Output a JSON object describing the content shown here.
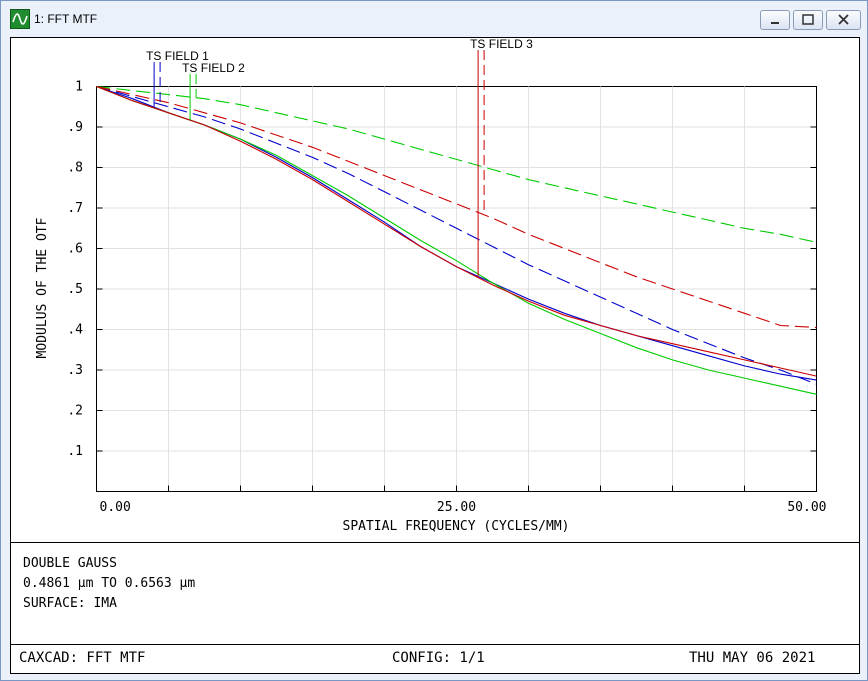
{
  "window": {
    "title": "1: FFT MTF",
    "icon": "sine-wave-icon",
    "controls": [
      "minimize-icon",
      "maximize-icon",
      "close-icon"
    ]
  },
  "info": {
    "lens": "DOUBLE GAUSS",
    "wavelength": "0.4861 µm TO 0.6563 µm",
    "surface": "SURFACE: IMA"
  },
  "footer": {
    "left": "CAXCAD: FFT MTF",
    "center": "CONFIG: 1/1",
    "right": "THU MAY 06 2021"
  },
  "chart_data": {
    "type": "line",
    "xlabel": "SPATIAL FREQUENCY (CYCLES/MM)",
    "ylabel": "MODULUS OF THE OTF",
    "xlim": [
      0,
      50
    ],
    "ylim": [
      0,
      1
    ],
    "x_tick_labels": [
      "0.00",
      "25.00",
      "50.00"
    ],
    "y_tick_labels": [
      "1",
      ".9",
      ".8",
      ".7",
      ".6",
      ".5",
      ".4",
      ".3",
      ".2",
      ".1"
    ],
    "grid": true,
    "x_grid_step": 5,
    "y_grid_step": 0.1,
    "colors": {
      "field1": "#0000cc",
      "field2": "#00cc00",
      "field3": "#cc0000"
    },
    "annotations": [
      {
        "label": "TS FIELD 1",
        "color": "#0000cc",
        "x": 4.0
      },
      {
        "label": "TS FIELD 2",
        "color": "#00cc00",
        "x": 6.5
      },
      {
        "label": "TS FIELD 3",
        "color": "#cc0000",
        "x": 26.5
      }
    ],
    "series": [
      {
        "field": "field1",
        "kind": "tangential",
        "color": "#0000cc",
        "dash": false,
        "x": [
          0,
          2.5,
          5,
          7.5,
          10,
          12.5,
          15,
          17.5,
          20,
          22.5,
          25,
          27.5,
          30,
          32.5,
          35,
          37.5,
          40,
          42.5,
          45,
          47.5,
          50
        ],
        "y": [
          1.0,
          0.97,
          0.935,
          0.905,
          0.87,
          0.825,
          0.775,
          0.72,
          0.665,
          0.605,
          0.555,
          0.515,
          0.475,
          0.44,
          0.41,
          0.385,
          0.36,
          0.335,
          0.31,
          0.29,
          0.275
        ]
      },
      {
        "field": "field1",
        "kind": "sagittal",
        "color": "#0000cc",
        "dash": true,
        "x": [
          0,
          2.5,
          5,
          7.5,
          10,
          12.5,
          15,
          17.5,
          20,
          22.5,
          25,
          27.5,
          30,
          32.5,
          35,
          37.5,
          40,
          42.5,
          45,
          47.5,
          50
        ],
        "y": [
          1.0,
          0.975,
          0.95,
          0.925,
          0.895,
          0.86,
          0.825,
          0.785,
          0.74,
          0.695,
          0.65,
          0.605,
          0.56,
          0.52,
          0.48,
          0.44,
          0.4,
          0.365,
          0.33,
          0.3,
          0.265
        ]
      },
      {
        "field": "field2",
        "kind": "tangential",
        "color": "#00cc00",
        "dash": false,
        "x": [
          0,
          2.5,
          5,
          7.5,
          10,
          12.5,
          15,
          17.5,
          20,
          22.5,
          25,
          27.5,
          30,
          32.5,
          35,
          37.5,
          40,
          42.5,
          45,
          47.5,
          50
        ],
        "y": [
          1.0,
          0.965,
          0.935,
          0.905,
          0.87,
          0.83,
          0.78,
          0.73,
          0.675,
          0.62,
          0.57,
          0.515,
          0.465,
          0.425,
          0.39,
          0.355,
          0.325,
          0.3,
          0.28,
          0.26,
          0.24
        ]
      },
      {
        "field": "field2",
        "kind": "sagittal",
        "color": "#00cc00",
        "dash": true,
        "x": [
          0,
          2.5,
          5,
          7.5,
          10,
          12.5,
          15,
          17.5,
          20,
          22.5,
          25,
          27.5,
          30,
          32.5,
          35,
          37.5,
          40,
          42.5,
          45,
          47.5,
          50
        ],
        "y": [
          1.0,
          0.99,
          0.98,
          0.97,
          0.955,
          0.935,
          0.915,
          0.895,
          0.87,
          0.845,
          0.82,
          0.795,
          0.77,
          0.75,
          0.73,
          0.71,
          0.69,
          0.67,
          0.65,
          0.635,
          0.615
        ]
      },
      {
        "field": "field3",
        "kind": "tangential",
        "color": "#cc0000",
        "dash": false,
        "x": [
          0,
          2.5,
          5,
          7.5,
          10,
          12.5,
          15,
          17.5,
          20,
          22.5,
          25,
          27.5,
          30,
          32.5,
          35,
          37.5,
          40,
          42.5,
          45,
          47.5,
          50
        ],
        "y": [
          1.0,
          0.965,
          0.935,
          0.905,
          0.865,
          0.82,
          0.77,
          0.715,
          0.66,
          0.605,
          0.555,
          0.51,
          0.47,
          0.435,
          0.41,
          0.385,
          0.365,
          0.345,
          0.325,
          0.305,
          0.285
        ]
      },
      {
        "field": "field3",
        "kind": "sagittal",
        "color": "#cc0000",
        "dash": true,
        "x": [
          0,
          2.5,
          5,
          7.5,
          10,
          12.5,
          15,
          17.5,
          20,
          22.5,
          25,
          27.5,
          30,
          32.5,
          35,
          37.5,
          40,
          42.5,
          45,
          47.5,
          50
        ],
        "y": [
          1.0,
          0.98,
          0.96,
          0.935,
          0.91,
          0.88,
          0.85,
          0.815,
          0.78,
          0.745,
          0.71,
          0.675,
          0.635,
          0.6,
          0.565,
          0.53,
          0.5,
          0.47,
          0.44,
          0.41,
          0.405
        ]
      }
    ]
  }
}
